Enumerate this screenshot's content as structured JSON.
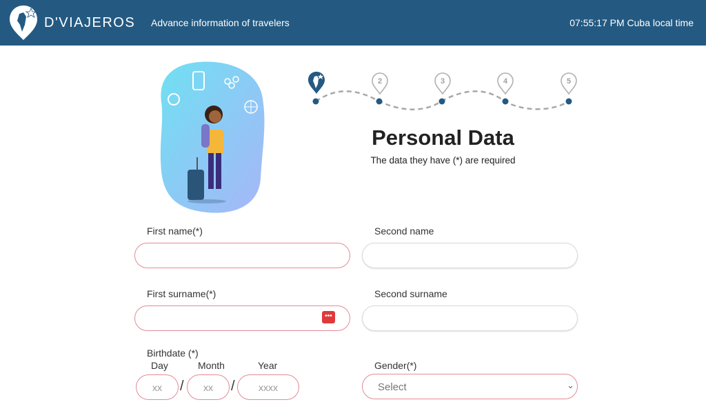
{
  "header": {
    "brand": "D'VIAJEROS",
    "tagline": "Advance information of travelers",
    "clock": "07:55:17 PM Cuba local time",
    "bg_color": "#245a82"
  },
  "steps": {
    "current": 1,
    "items": [
      {
        "label": "1",
        "icon": "traveler-pin-icon",
        "active": true
      },
      {
        "label": "2",
        "active": false
      },
      {
        "label": "3",
        "active": false
      },
      {
        "label": "4",
        "active": false
      },
      {
        "label": "5",
        "active": false
      }
    ]
  },
  "page": {
    "title": "Personal Data",
    "subtitle": "The data they have (*) are required"
  },
  "form": {
    "first_name": {
      "label": "First name(*)",
      "value": "",
      "placeholder": ""
    },
    "second_name": {
      "label": "Second name",
      "value": "",
      "placeholder": ""
    },
    "first_surname": {
      "label": "First surname(*)",
      "value": "",
      "placeholder": ""
    },
    "second_surname": {
      "label": "Second surname",
      "value": "",
      "placeholder": ""
    },
    "birthdate": {
      "label": "Birthdate (*)",
      "day": {
        "label": "Day",
        "placeholder": "xx"
      },
      "month": {
        "label": "Month",
        "placeholder": "xx"
      },
      "year": {
        "label": "Year",
        "placeholder": "xxxx"
      },
      "separator": "/"
    },
    "gender": {
      "label": "Gender(*)",
      "selected": "Select"
    },
    "password_manager_icon": "•••"
  },
  "colors": {
    "required_border": "#e38a97",
    "accent": "#245a82",
    "alert_icon": "#e0393b"
  }
}
